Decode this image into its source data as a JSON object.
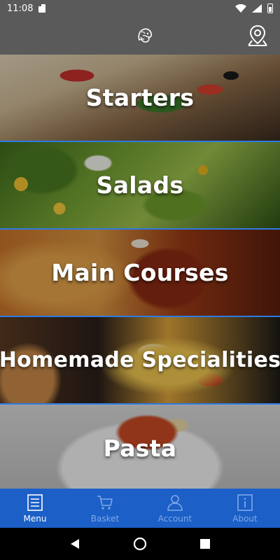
{
  "status_bar": {
    "time": "11:08",
    "icons": [
      "sd-card-icon",
      "wifi-icon",
      "signal-icon",
      "battery-icon"
    ]
  },
  "app_bar": {
    "logo_icon": "lion-logo-icon",
    "location_icon": "map-pin-icon"
  },
  "menu": {
    "categories": [
      {
        "label": "Starters"
      },
      {
        "label": "Salads"
      },
      {
        "label": "Main Courses"
      },
      {
        "label": "Homemade Specialities"
      },
      {
        "label": "Pasta"
      }
    ]
  },
  "bottom_nav": {
    "items": [
      {
        "label": "Menu",
        "icon": "menu-list-icon",
        "active": true
      },
      {
        "label": "Basket",
        "icon": "basket-icon",
        "active": false
      },
      {
        "label": "Account",
        "icon": "person-icon",
        "active": false
      },
      {
        "label": "About",
        "icon": "info-icon",
        "active": false
      }
    ]
  },
  "colors": {
    "app_bar": "#5a5a5a",
    "bottom_nav": "#1b5fc7",
    "tile_divider": "#2c7be5",
    "nav_active": "#ffffff",
    "nav_inactive": "#7fa8e6"
  }
}
